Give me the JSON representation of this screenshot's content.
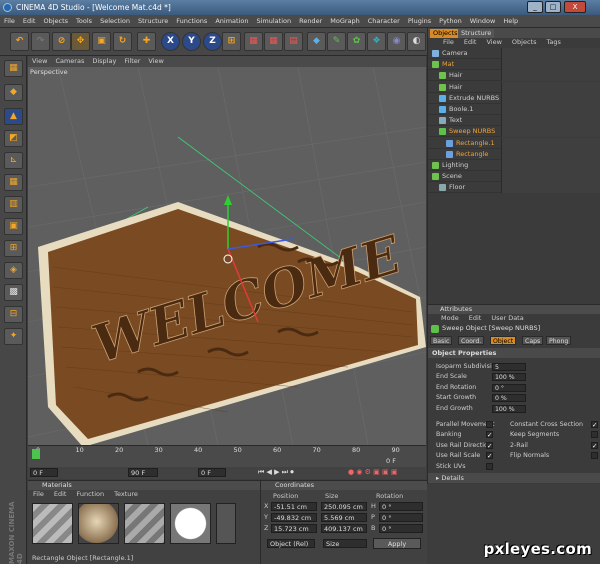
{
  "window": {
    "title": "CINEMA 4D Studio - [Welcome Mat.c4d *]",
    "min": "_",
    "max": "□",
    "close": "X"
  },
  "menu": [
    "File",
    "Edit",
    "Objects",
    "Tools",
    "Selection",
    "Structure",
    "Functions",
    "Animation",
    "Simulation",
    "Render",
    "MoGraph",
    "Character",
    "Plugins",
    "Python",
    "Window",
    "Help"
  ],
  "viewport": {
    "menu": [
      "View",
      "Cameras",
      "Display",
      "Filter",
      "View"
    ],
    "label": "Perspective",
    "scene_text": "WELCOME"
  },
  "timeline": {
    "ticks": [
      "0",
      "10",
      "20",
      "30",
      "40",
      "50",
      "60",
      "70",
      "80",
      "90"
    ],
    "current_frame": "0 F",
    "start": "0 F",
    "end": "0 F",
    "end2": "90 F",
    "end_field": "90 F",
    "end_right": "0 F"
  },
  "materials": {
    "title": "Materials",
    "menu": [
      "File",
      "Edit",
      "Function",
      "Texture"
    ],
    "status": "Rectangle Object [Rectangle.1]"
  },
  "coordinates": {
    "title": "Coordinates",
    "headers": [
      "Position",
      "Size",
      "Rotation"
    ],
    "rows": [
      {
        "axis": "X",
        "pos": "-51.51 cm",
        "size": "250.095 cm",
        "rot_axis": "H",
        "rot": "0 °"
      },
      {
        "axis": "Y",
        "pos": "-49.832 cm",
        "size": "5.569 cm",
        "rot_axis": "P",
        "rot": "0 °"
      },
      {
        "axis": "Z",
        "pos": "15.723 cm",
        "size": "409.137 cm",
        "rot_axis": "B",
        "rot": "0 °"
      }
    ],
    "mode_select": "Object (Rel)",
    "size_select": "Size",
    "apply": "Apply"
  },
  "object_manager": {
    "tabs": [
      "Objects",
      "Structure"
    ],
    "menu": [
      "File",
      "Edit",
      "View",
      "Objects",
      "Tags"
    ],
    "items": [
      {
        "name": "Camera",
        "indent": 0,
        "orange": false,
        "icon": "#7fb1e0"
      },
      {
        "name": "Mat",
        "indent": 0,
        "orange": true,
        "icon": "#6fc24d"
      },
      {
        "name": "Hair",
        "indent": 1,
        "orange": false,
        "icon": "#6fc24d"
      },
      {
        "name": "Hair",
        "indent": 1,
        "orange": false,
        "icon": "#6fc24d"
      },
      {
        "name": "Extrude NURBS",
        "indent": 1,
        "orange": false,
        "icon": "#5ab0e8"
      },
      {
        "name": "Boole.1",
        "indent": 1,
        "orange": false,
        "icon": "#5ab0e8"
      },
      {
        "name": "Text",
        "indent": 1,
        "orange": false,
        "icon": "#8ab"
      },
      {
        "name": "Sweep NURBS",
        "indent": 1,
        "orange": true,
        "icon": "#5ec24a"
      },
      {
        "name": "Rectangle.1",
        "indent": 2,
        "orange": true,
        "icon": "#6aa0e0"
      },
      {
        "name": "Rectangle",
        "indent": 2,
        "orange": true,
        "icon": "#6aa0e0"
      },
      {
        "name": "Lighting",
        "indent": 0,
        "orange": false,
        "icon": "#6fc24d"
      },
      {
        "name": "Scene",
        "indent": 0,
        "orange": false,
        "icon": "#6fc24d"
      },
      {
        "name": "Floor",
        "indent": 1,
        "orange": false,
        "icon": "#8aa"
      }
    ]
  },
  "attributes": {
    "title": "Attributes",
    "menu": [
      "Mode",
      "Edit",
      "User Data"
    ],
    "object_label": "Sweep Object [Sweep NURBS]",
    "tabs": [
      "Basic",
      "Coord.",
      "Object",
      "Caps",
      "Phong"
    ],
    "section": "Object Properties",
    "fields": [
      {
        "label": "Isoparm Subdivision",
        "value": "5"
      },
      {
        "label": "End Scale",
        "value": "100 %"
      },
      {
        "label": "End Rotation",
        "value": "0 °"
      },
      {
        "label": "Start Growth",
        "value": "0 %"
      },
      {
        "label": "End Growth",
        "value": "100 %"
      }
    ],
    "checks_left": [
      {
        "label": "Parallel Movement",
        "checked": false
      },
      {
        "label": "Banking",
        "checked": true
      },
      {
        "label": "Use Rail Direction",
        "checked": true
      },
      {
        "label": "Use Rail Scale",
        "checked": true
      },
      {
        "label": "Stick UVs",
        "checked": false
      }
    ],
    "checks_right": [
      {
        "label": "Constant Cross Section",
        "checked": true
      },
      {
        "label": "Keep Segments",
        "checked": false
      },
      {
        "label": "2-Rail",
        "checked": true
      },
      {
        "label": "Flip Normals",
        "checked": false
      }
    ],
    "details": "Details"
  },
  "watermark": "pxleyes.com",
  "maxon": "MAXON CINEMA 4D"
}
